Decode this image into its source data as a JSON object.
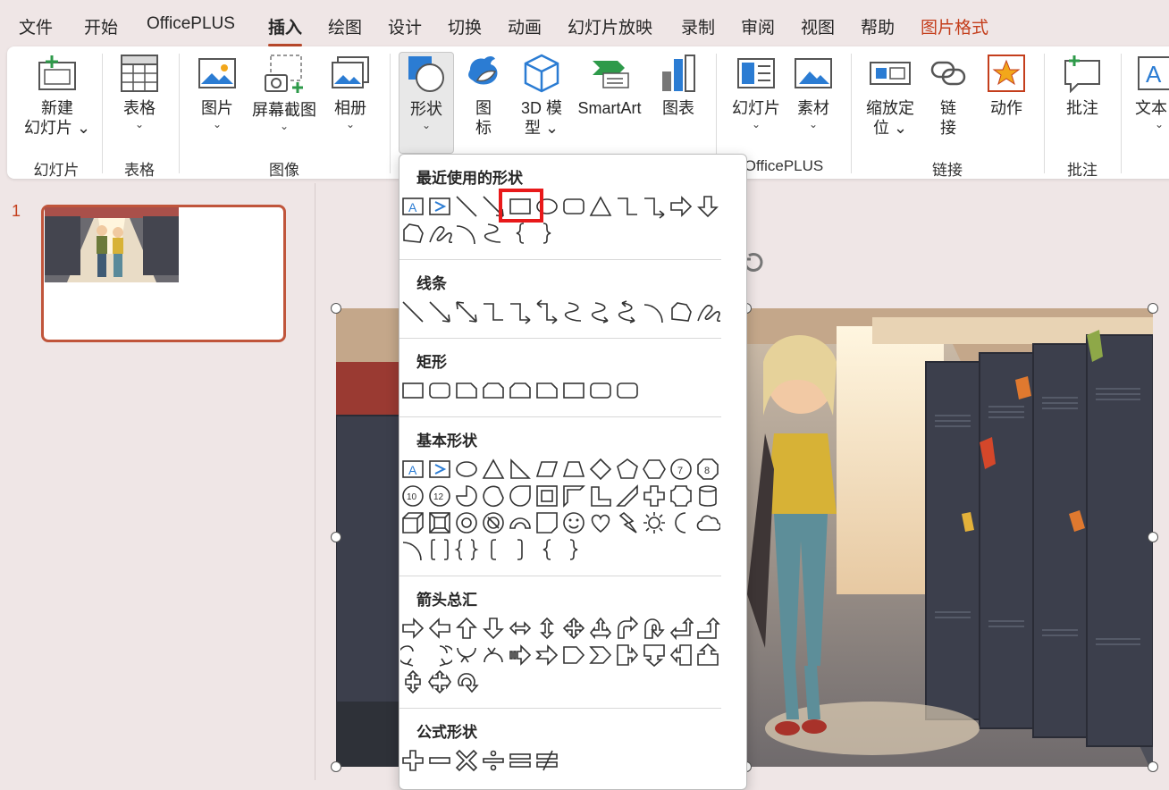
{
  "menu": {
    "tabs": [
      "文件",
      "开始",
      "OfficePLUS",
      "插入",
      "绘图",
      "设计",
      "切换",
      "动画",
      "幻灯片放映",
      "录制",
      "审阅",
      "视图",
      "帮助",
      "图片格式"
    ],
    "active_tab": "插入",
    "contextual_tab": "图片格式"
  },
  "ribbon": {
    "new_slide": [
      "新建",
      "幻灯片"
    ],
    "table": "表格",
    "picture": "图片",
    "screenshot": "屏幕截图",
    "album": "相册",
    "shapes": "形状",
    "icons": [
      "图",
      "标"
    ],
    "model3d": [
      "3D 模",
      "型"
    ],
    "smartart": "SmartArt",
    "chart": "图表",
    "slides_officeplus": "幻灯片",
    "material": "素材",
    "zoom": [
      "缩放定",
      "位"
    ],
    "link": [
      "链",
      "接"
    ],
    "action": "动作",
    "comment": "批注",
    "textbox": "文本",
    "groups": {
      "slides": "幻灯片",
      "tables": "表格",
      "images": "图像",
      "officeplus": "OfficePLUS",
      "links": "链接",
      "comments": "批注"
    }
  },
  "slides_panel": {
    "number": "1"
  },
  "shapes_gallery": {
    "recent": "最近使用的形状",
    "lines": "线条",
    "rectangles": "矩形",
    "basic": "基本形状",
    "arrows": "箭头总汇",
    "equation": "公式形状",
    "highlighted_shape": "rectangle"
  },
  "colors": {
    "accent": "#c43e1c",
    "ribbon_blue": "#2b7cd3",
    "highlight": "#e8191a"
  }
}
